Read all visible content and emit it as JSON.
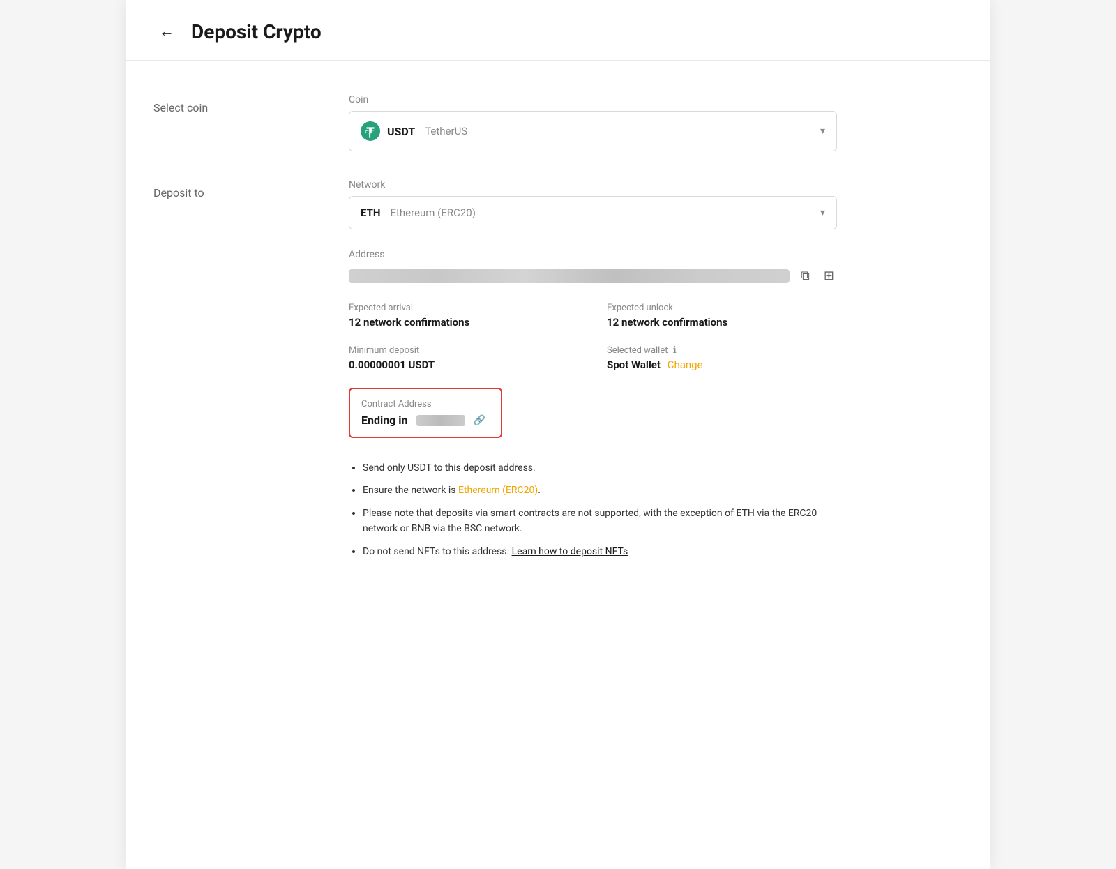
{
  "header": {
    "back_label": "←",
    "title": "Deposit Crypto"
  },
  "select_coin": {
    "row_label": "Select coin",
    "field_label": "Coin",
    "coin_symbol": "USDT",
    "coin_name": "TetherUS"
  },
  "deposit_to": {
    "row_label": "Deposit to",
    "network_label": "Network",
    "network_short": "ETH",
    "network_full": "Ethereum (ERC20)",
    "address_label": "Address"
  },
  "info": {
    "expected_arrival_label": "Expected arrival",
    "expected_arrival_value": "12 network confirmations",
    "expected_unlock_label": "Expected unlock",
    "expected_unlock_value": "12 network confirmations",
    "min_deposit_label": "Minimum deposit",
    "min_deposit_value": "0.00000001 USDT",
    "selected_wallet_label": "Selected wallet",
    "selected_wallet_value": "Spot Wallet",
    "change_label": "Change",
    "wallet_info_icon": "ℹ"
  },
  "contract": {
    "label": "Contract Address",
    "ending_in_label": "Ending in"
  },
  "bullets": [
    {
      "text_before": "Send only USDT to this deposit address.",
      "highlight": "",
      "text_after": ""
    },
    {
      "text_before": "Ensure the network is ",
      "highlight": "Ethereum (ERC20)",
      "text_after": "."
    },
    {
      "text_before": "Please note that deposits via smart contracts are not supported, with the exception of ETH via the ERC20 network or BNB via the BSC network.",
      "highlight": "",
      "text_after": ""
    },
    {
      "text_before": "Do not send NFTs to this address. ",
      "highlight": "",
      "text_after": "Learn how to deposit NFTs",
      "link": true
    }
  ],
  "icons": {
    "copy": "⧉",
    "qr": "⊞",
    "chain": "⛓",
    "chevron": "▾"
  }
}
